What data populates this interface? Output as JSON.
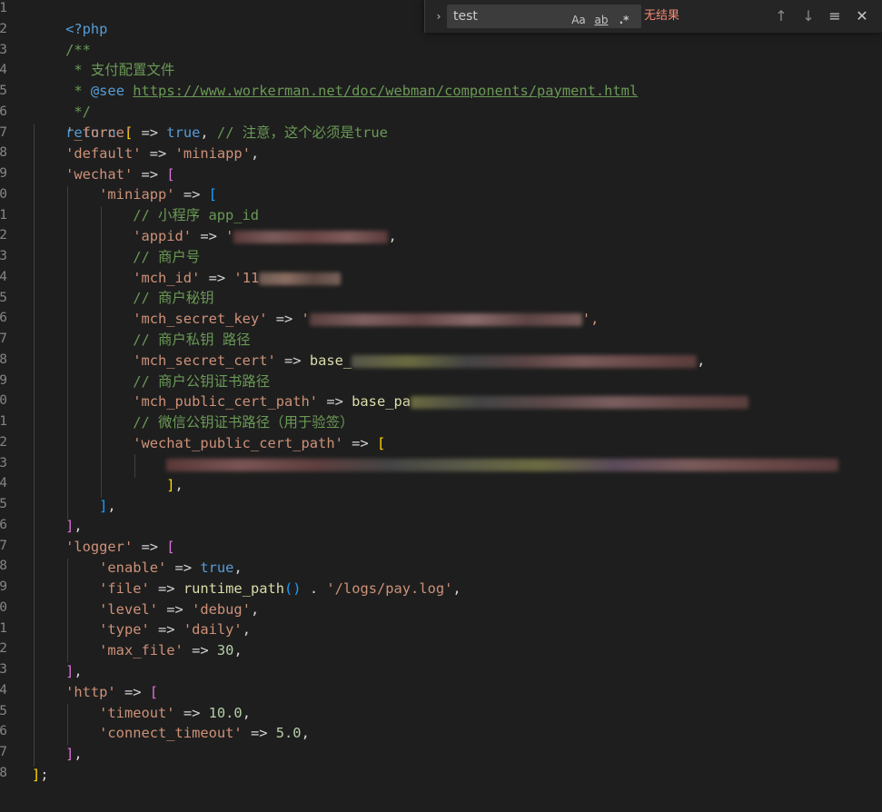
{
  "gutter": {
    "numbers": [
      "1",
      "2",
      "3",
      "4",
      "5",
      "6",
      "7",
      "8",
      "9",
      "0",
      "1",
      "2",
      "3",
      "4",
      "5",
      "6",
      "7",
      "8",
      "9",
      "0",
      "1",
      "2",
      "3",
      "4",
      "5",
      "6",
      "7",
      "8",
      "9",
      "0",
      "1",
      "2",
      "3",
      "4",
      "5",
      "6",
      "7",
      "8"
    ]
  },
  "code": {
    "l1_php": "<?php",
    "l2_doc_open": "/**",
    "l3_star": " * ",
    "l3_text": "支付配置文件",
    "l4_star": " * ",
    "l4_tag": "@see",
    "l4_link": "https://www.workerman.net/doc/webman/components/payment.html",
    "l5_doc_close": " */",
    "l6_return": "return",
    "l6_bracket": "[",
    "l7_key": "'_force'",
    "l7_arrow": " => ",
    "l7_val": "true",
    "l7_comma": ", ",
    "l7_comment": "// 注意，这个必须是true",
    "l8_key": "'default'",
    "l8_arrow": " => ",
    "l8_val": "'miniapp'",
    "l8_comma": ",",
    "l9_key": "'wechat'",
    "l9_arrow": " => ",
    "l9_bracket": "[",
    "l10_key": "'miniapp'",
    "l10_arrow": " => ",
    "l10_bracket": "[",
    "l11_comment": "// 小程序 app_id",
    "l12_key": "'appid'",
    "l12_arrow": " => ",
    "l12_quote": "'",
    "l12_comma": ",",
    "l13_comment": "// 商户号",
    "l14_key": "'mch_id'",
    "l14_arrow": " => ",
    "l14_val": "'11",
    "l15_comment": "// 商户秘钥",
    "l16_key": "'mch_secret_key'",
    "l16_arrow": " => ",
    "l16_quote": "'",
    "l16_end": "',",
    "l17_comment": "// 商户私钥 路径",
    "l18_key": "'mch_secret_cert'",
    "l18_arrow": " => ",
    "l18_fn": "base_",
    "l18_comma": ",",
    "l19_comment": "// 商户公钥证书路径",
    "l20_key": "'mch_public_cert_path'",
    "l20_arrow": " => ",
    "l20_fn": "base_pa",
    "l21_comment": "// 微信公钥证书路径（用于验签）",
    "l22_key": "'wechat_public_cert_path'",
    "l22_arrow": " => ",
    "l22_bracket": "[",
    "l24_bracket": "]",
    "l24_comma": ",",
    "l25_bracket": "]",
    "l25_comma": ",",
    "l26_bracket": "]",
    "l26_comma": ",",
    "l27_key": "'logger'",
    "l27_arrow": " => ",
    "l27_bracket": "[",
    "l28_key": "'enable'",
    "l28_arrow": " => ",
    "l28_val": "true",
    "l28_comma": ",",
    "l29_key": "'file'",
    "l29_arrow": " => ",
    "l29_fn": "runtime_path",
    "l29_paren": "()",
    "l29_dot": " . ",
    "l29_val": "'/logs/pay.log'",
    "l29_comma": ",",
    "l30_key": "'level'",
    "l30_arrow": " => ",
    "l30_val": "'debug'",
    "l30_comma": ",",
    "l31_key": "'type'",
    "l31_arrow": " => ",
    "l31_val": "'daily'",
    "l31_comma": ",",
    "l32_key": "'max_file'",
    "l32_arrow": " => ",
    "l32_val": "30",
    "l32_comma": ",",
    "l33_bracket": "]",
    "l33_comma": ",",
    "l34_key": "'http'",
    "l34_arrow": " => ",
    "l34_bracket": "[",
    "l35_key": "'timeout'",
    "l35_arrow": " => ",
    "l35_val": "10.0",
    "l35_comma": ",",
    "l36_key": "'connect_timeout'",
    "l36_arrow": " => ",
    "l36_val": "5.0",
    "l36_comma": ",",
    "l37_bracket": "]",
    "l37_comma": ",",
    "l38_bracket": "]",
    "l38_semi": ";"
  },
  "find_widget": {
    "toggle_icon": "chevron-right-icon",
    "toggle_glyph": "›",
    "query": "test",
    "match_case_label": "Aa",
    "whole_word_label": "ab",
    "regex_label": ".*",
    "status": "无结果",
    "prev_glyph": "↑",
    "next_glyph": "↓",
    "selection_glyph": "≡",
    "close_glyph": "✕"
  },
  "colors": {
    "background": "#1e1e1e",
    "keyword": "#569cd6",
    "string": "#ce9178",
    "comment": "#6a9955",
    "function": "#dcdcaa",
    "number": "#b5cea8",
    "no_result": "#f48771"
  }
}
